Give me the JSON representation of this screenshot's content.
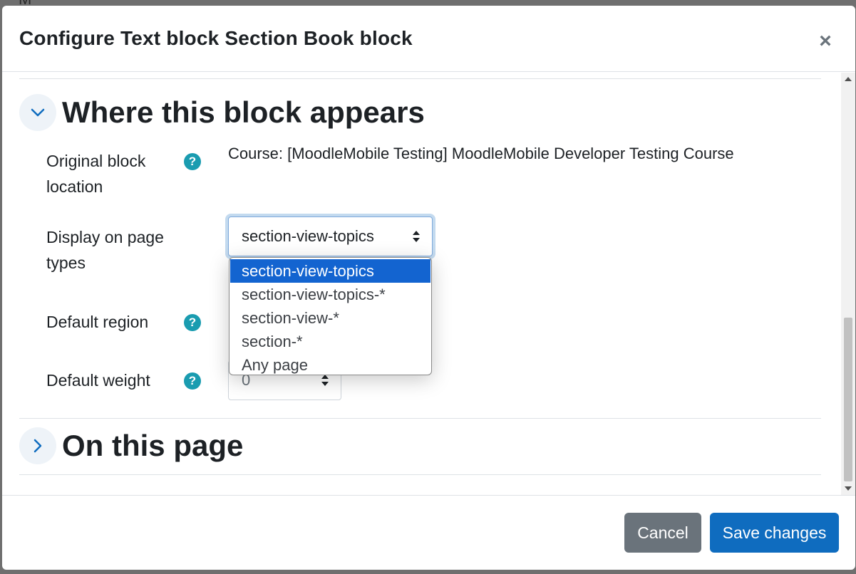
{
  "modal": {
    "title": "Configure Text block Section Book block",
    "close_symbol": "×"
  },
  "section_where": {
    "title": "Where this block appears",
    "toggle_icon": "chevron-down-icon",
    "fields": {
      "original_location": {
        "label": "Original block location",
        "value": "Course: [MoodleMobile Testing] MoodleMobile Developer Testing Course"
      },
      "page_types": {
        "label": "Display on page types",
        "selected": "section-view-topics",
        "options": [
          "section-view-topics",
          "section-view-topics-*",
          "section-view-*",
          "section-*",
          "Any page"
        ]
      },
      "default_region": {
        "label": "Default region"
      },
      "default_weight": {
        "label": "Default weight",
        "value": "0"
      }
    }
  },
  "section_on_page": {
    "title": "On this page",
    "toggle_icon": "chevron-right-icon"
  },
  "help_symbol": "?",
  "footer": {
    "cancel_label": "Cancel",
    "save_label": "Save changes"
  },
  "colors": {
    "primary": "#0f6cbf",
    "secondary": "#6a737b",
    "help": "#1a9cb0",
    "selected_option": "#1364d0"
  }
}
